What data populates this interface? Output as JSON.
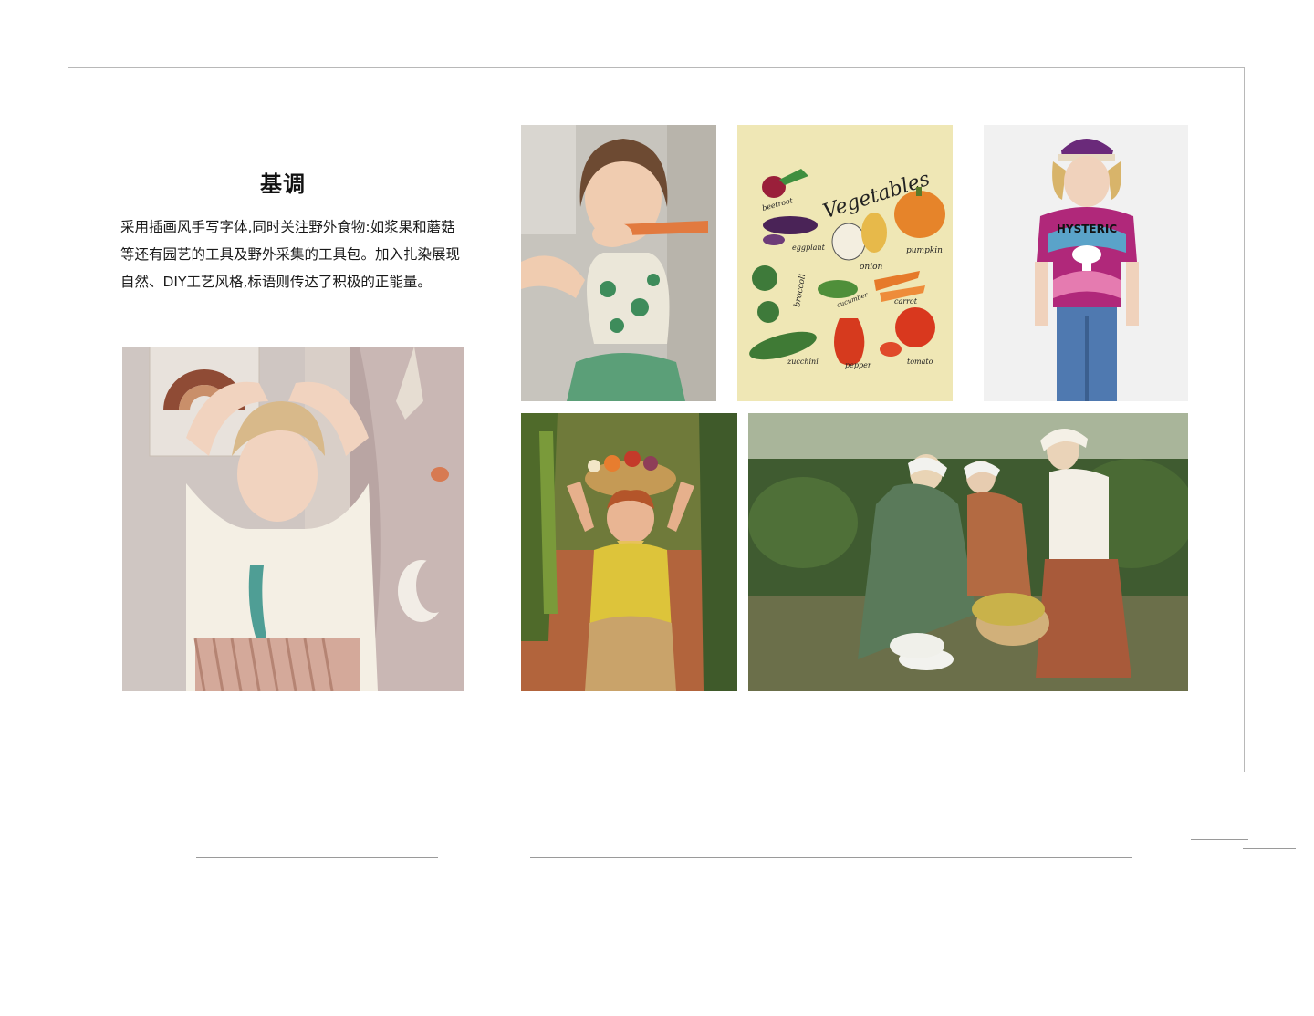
{
  "section": {
    "title": "基调",
    "description_lines": [
      "采用插画风手写字体,同时关注野外食物:如浆果和蘑菇",
      "等还有园艺的工具及野外采集的工具包。加入扎染展现",
      "自然、DIY工艺风格,标语则传达了积极的正能量。"
    ]
  },
  "illustration": {
    "heading": "Vegetables",
    "labels": {
      "beetroot": "beetroot",
      "eggplant": "eggplant",
      "onion": "onion",
      "pumpkin": "pumpkin",
      "broccoli": "broccoli",
      "cucumber": "cucumber",
      "carrot": "carrot",
      "zucchini": "zucchini",
      "pepper": "pepper",
      "tomato": "tomato"
    }
  },
  "shirt_print": "HYSTERIC",
  "colors": {
    "border": "#b8b8b8",
    "illustration_bg": "#efe7b5",
    "tiedye_magenta": "#b0287a"
  }
}
